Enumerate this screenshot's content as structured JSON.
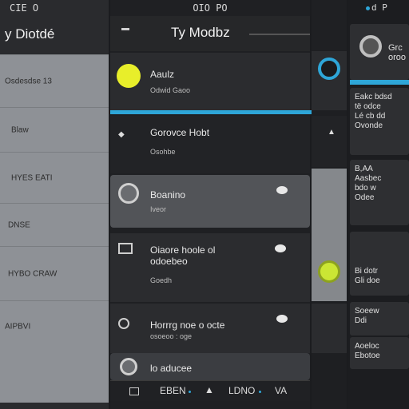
{
  "left_panel": {
    "status": "CIE O",
    "title": "y Diotdé",
    "rows": [
      {
        "label": "Osdesdse 13"
      },
      {
        "label": "Blaw"
      },
      {
        "label": "HYES EATI"
      },
      {
        "label": "DNSE"
      },
      {
        "label": "HYBO CRAW"
      },
      {
        "label": "AIPBVI"
      }
    ]
  },
  "middle_panel": {
    "status": "OIO PO",
    "title": "Ty Modbz",
    "cards": [
      {
        "title": "Aaulz",
        "subtitle": "Odwid Gaoo"
      },
      {
        "title": "Gorovce Hobt",
        "subtitle": "Osohbe"
      },
      {
        "title": "Boanino",
        "subtitle": "Iveor"
      },
      {
        "title": "Oiaore hoole ol",
        "title2": "odoebeo",
        "subtitle": "Goedh"
      },
      {
        "title": "Horrrg noe o octe",
        "subtitle": "osoeoo : oge"
      },
      {
        "title": "lo aducee"
      }
    ],
    "bottom_nav": {
      "items": [
        "EBEN",
        "LDNO",
        "VA"
      ]
    }
  },
  "right_panel": {
    "status": "d P",
    "profile_name": "Grc oroo",
    "cards": [
      {
        "lines": [
          "Eakc bdsd",
          "të odce",
          "Lé cb dd",
          "Ovonde"
        ]
      },
      {
        "lines": [
          "B,AA",
          "Aasbec",
          "bdo w",
          "Odee"
        ]
      },
      {
        "lines": [
          "Bi dotr",
          "Gli doe"
        ]
      },
      {
        "lines": [
          "Soeew",
          "Ddi"
        ]
      },
      {
        "lines": [
          "Aoeloc",
          "Ebotoe"
        ]
      }
    ]
  },
  "colors": {
    "accent": "#2ea6d8",
    "yellow": "#e8ee2a",
    "lime": "#cbe634",
    "list_bg": "#8e9196"
  }
}
